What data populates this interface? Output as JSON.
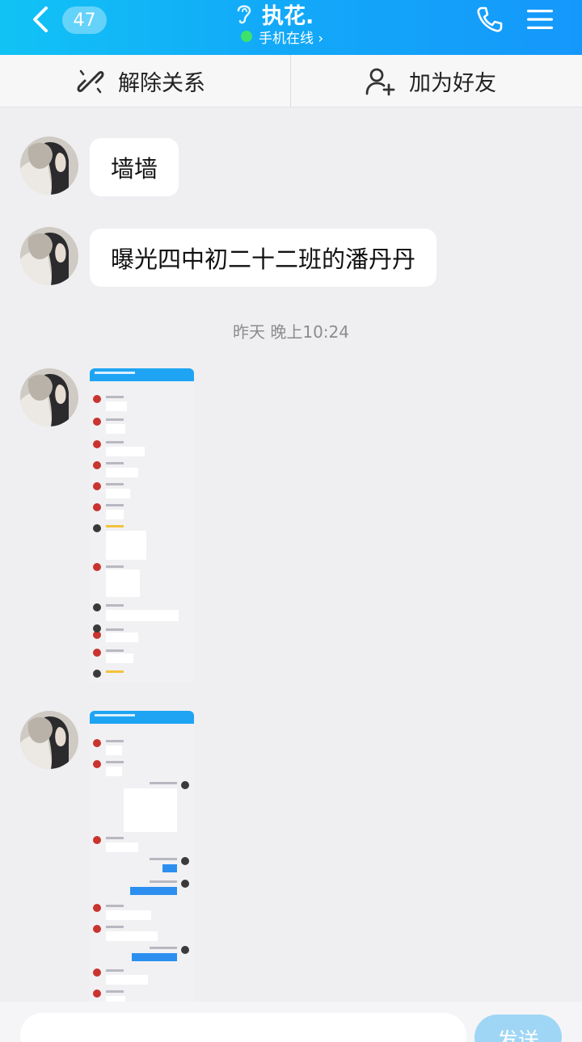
{
  "header": {
    "back_badge": "47",
    "title": "执花.",
    "status": "手机在线 ›",
    "accent_color": "#12aaf8",
    "icons": [
      "back-arrow-icon",
      "ear-icon",
      "phone-icon",
      "menu-icon"
    ]
  },
  "actions": {
    "unbind_label": "解除关系",
    "add_friend_label": "加为好友"
  },
  "messages": [
    {
      "type": "text",
      "text": "墙墙"
    },
    {
      "type": "text",
      "text": "曝光四中初二十二班的潘丹丹"
    },
    {
      "type": "image",
      "description_icon": "screenshot-thumbnail"
    },
    {
      "type": "image",
      "description_icon": "screenshot-thumbnail"
    }
  ],
  "timestamp": "昨天 晚上10:24",
  "input": {
    "placeholder": "",
    "send_label": "发送"
  }
}
